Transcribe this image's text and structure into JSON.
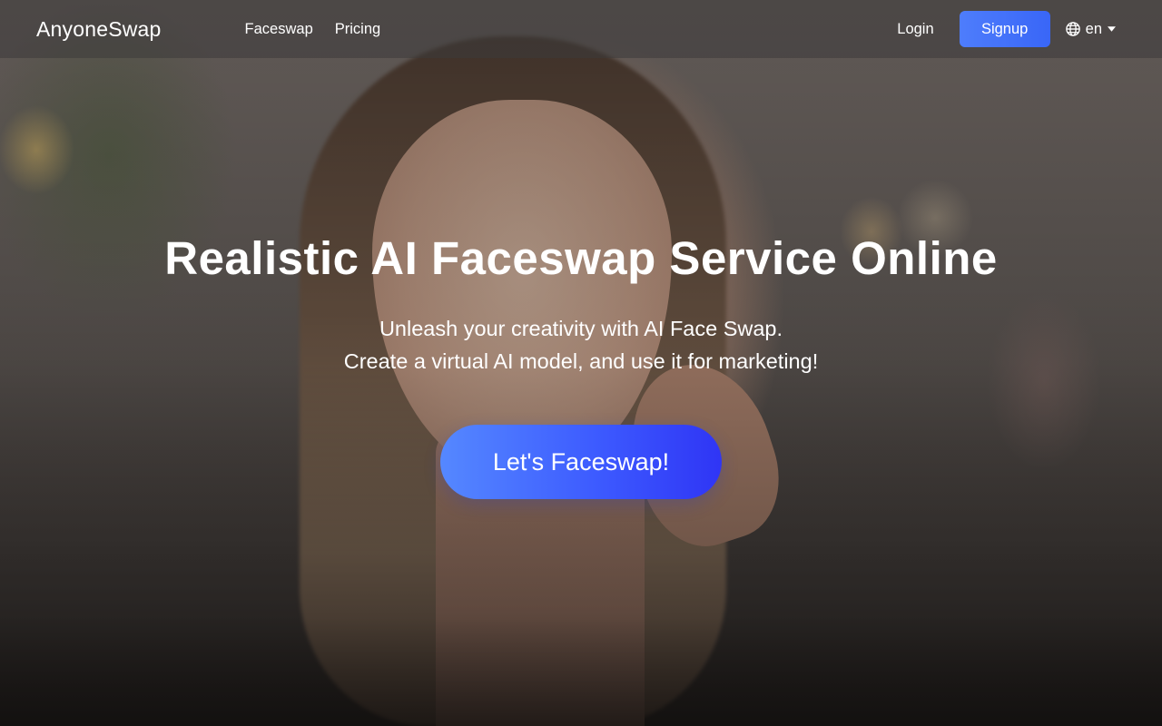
{
  "navbar": {
    "logo": "AnyoneSwap",
    "links": [
      "Faceswap",
      "Pricing"
    ],
    "login": "Login",
    "signup": "Signup",
    "language": "en"
  },
  "hero": {
    "title": "Realistic AI Faceswap Service Online",
    "subtitle_line1": "Unleash your creativity with AI Face Swap.",
    "subtitle_line2": "Create a virtual AI model, and use it for marketing!",
    "cta": "Let's Faceswap!"
  },
  "colors": {
    "accent": "#4e7dfc",
    "cta_gradient_start": "#5588ff",
    "cta_gradient_end": "#2f35f5"
  },
  "icons": {
    "language": "globe-icon",
    "dropdown": "caret-down-icon"
  }
}
